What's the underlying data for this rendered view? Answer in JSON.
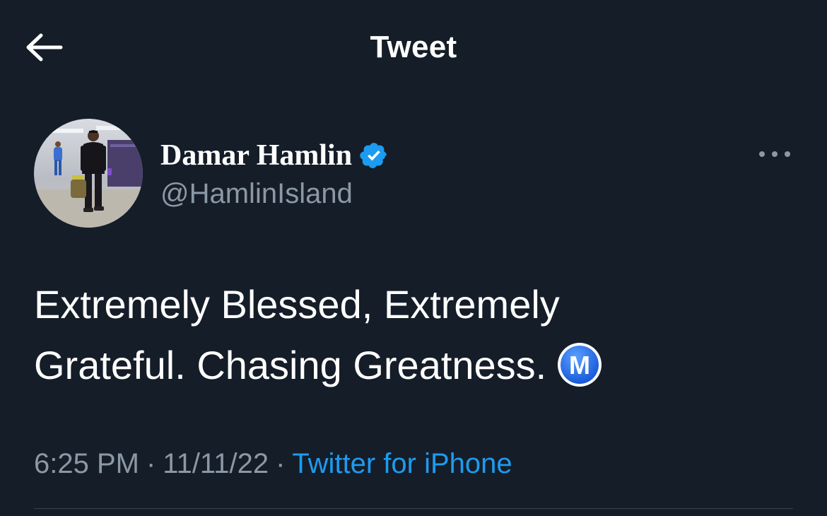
{
  "header": {
    "title": "Tweet",
    "back_icon": "arrow-left-icon"
  },
  "author": {
    "name": "Damar Hamlin",
    "handle": "@HamlinIsland",
    "verified": true,
    "verified_icon": "verified-badge-icon",
    "verified_color": "#1d9bf0",
    "more_icon": "more-horizontal-icon"
  },
  "tweet": {
    "line1": "Extremely Blessed, Extremely",
    "line2": "Grateful. Chasing Greatness.",
    "emoji": "M",
    "emoji_icon": "circled-m-emoji"
  },
  "meta": {
    "time": "6:25 PM",
    "date": "11/11/22",
    "separator": "·",
    "source": "Twitter for iPhone"
  },
  "colors": {
    "background": "#151d28",
    "text": "#ffffff",
    "secondary_text": "#8b98a5",
    "accent": "#1d9bf0",
    "divider": "#38444d"
  }
}
